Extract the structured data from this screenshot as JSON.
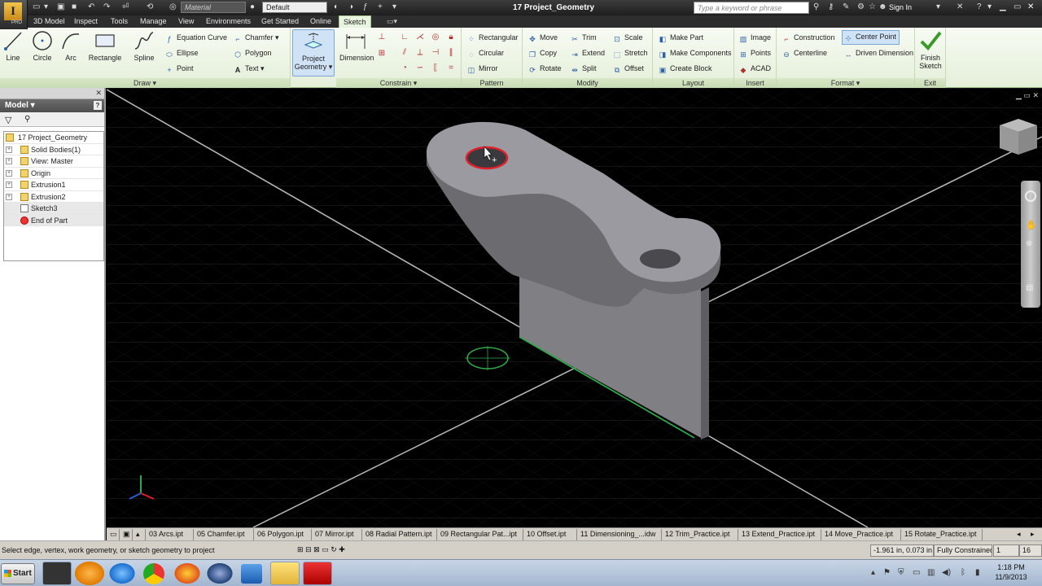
{
  "app": {
    "logo_letter": "I",
    "logo_sub": "PRO",
    "title": "17 Project_Geometry",
    "material_placeholder": "Material",
    "appearance": "Default",
    "search_placeholder": "Type a keyword or phrase",
    "sign_in": "Sign In"
  },
  "tabs": [
    "3D Model",
    "Inspect",
    "Tools",
    "Manage",
    "View",
    "Environments",
    "Get Started",
    "Online",
    "Sketch"
  ],
  "active_tab": "Sketch",
  "ribbon": {
    "draw": {
      "label": "Draw",
      "line": "Line",
      "circle": "Circle",
      "arc": "Arc",
      "rectangle": "Rectangle",
      "spline": "Spline",
      "equation_curve": "Equation Curve",
      "ellipse": "Ellipse",
      "point": "Point",
      "chamfer": "Chamfer",
      "polygon": "Polygon",
      "text": "Text",
      "project_geometry_1": "Project",
      "project_geometry_2": "Geometry"
    },
    "constrain": {
      "label": "Constrain",
      "dimension": "Dimension"
    },
    "pattern": {
      "label": "Pattern",
      "rectangular": "Rectangular",
      "circular": "Circular",
      "mirror": "Mirror"
    },
    "modify": {
      "label": "Modify",
      "move": "Move",
      "copy": "Copy",
      "rotate": "Rotate",
      "trim": "Trim",
      "extend": "Extend",
      "split": "Split",
      "scale": "Scale",
      "stretch": "Stretch",
      "offset": "Offset"
    },
    "layout": {
      "label": "Layout",
      "make_part": "Make Part",
      "make_components": "Make Components",
      "create_block": "Create Block"
    },
    "insert": {
      "label": "Insert",
      "image": "Image",
      "points": "Points",
      "acad": "ACAD"
    },
    "format": {
      "label": "Format",
      "construction": "Construction",
      "centerline": "Centerline",
      "center_point": "Center Point",
      "driven_dimension": "Driven Dimension"
    },
    "exit": {
      "label": "Exit",
      "finish_1": "Finish",
      "finish_2": "Sketch"
    }
  },
  "browser": {
    "title": "Model",
    "help": "?",
    "tree": [
      {
        "label": "17 Project_Geometry",
        "icon": "part-icon"
      },
      {
        "label": "Solid Bodies(1)",
        "icon": "solid-bodies-icon"
      },
      {
        "label": "View: Master",
        "icon": "view-icon"
      },
      {
        "label": "Origin",
        "icon": "folder-icon"
      },
      {
        "label": "Extrusion1",
        "icon": "extrusion-icon"
      },
      {
        "label": "Extrusion2",
        "icon": "extrusion-icon"
      },
      {
        "label": "Sketch3",
        "icon": "sketch-icon"
      },
      {
        "label": "End of Part",
        "icon": "end-of-part-icon"
      }
    ]
  },
  "doc_tabs": [
    "03 Arcs.ipt",
    "05 Chamfer.ipt",
    "06 Polygon.ipt",
    "07 Mirror.ipt",
    "08 Radial Pattern.ipt",
    "09 Rectangular Pat...ipt",
    "10 Offset.ipt",
    "11 Dimensioning_...idw",
    "12 Trim_Practice.ipt",
    "13 Extend_Practice.ipt",
    "14 Move_Practice.ipt",
    "15 Rotate_Practice.ipt"
  ],
  "status": {
    "message": "Select edge, vertex, work geometry, or sketch geometry to project",
    "coords": "-1.961 in, 0.073 in",
    "constraint": "Fully Constrained",
    "count1": "1",
    "count2": "16"
  },
  "taskbar": {
    "start": "Start",
    "time": "1:18 PM",
    "date": "11/9/2013"
  },
  "colors": {
    "ribbon_bg": "#e4efd9",
    "viewport_bg": "#000000",
    "part_gray": "#8e8e94",
    "highlight_red": "#e0202a",
    "sketch_green": "#2fa84a"
  }
}
